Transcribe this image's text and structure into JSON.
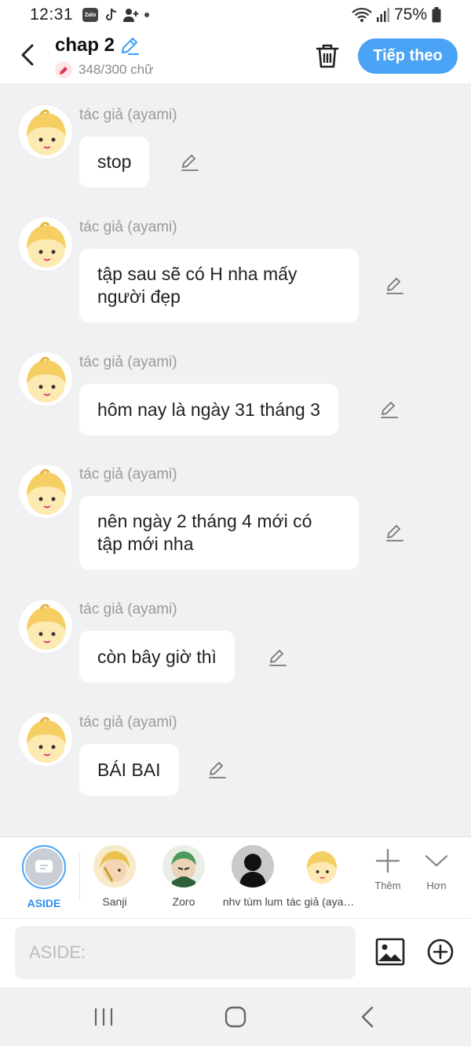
{
  "status_bar": {
    "time": "12:31",
    "battery": "75%",
    "icons": [
      "zalo-icon",
      "tiktok-icon",
      "person-add-icon",
      "dot-icon",
      "wifi-icon",
      "signal-icon",
      "battery-icon"
    ]
  },
  "header": {
    "title": "chap 2",
    "word_count": "348/300 chữ",
    "next_label": "Tiếp theo",
    "accent_color": "#4aa3f5"
  },
  "messages": [
    {
      "author": "tác giả (ayami)",
      "text": "stop"
    },
    {
      "author": "tác giả (ayami)",
      "text": "tập sau sẽ có H nha mấy người đẹp"
    },
    {
      "author": "tác giả (ayami)",
      "text": "hôm nay là ngày 31 tháng 3"
    },
    {
      "author": "tác giả (ayami)",
      "text": "nên ngày 2 tháng 4 mới có tập mới nha"
    },
    {
      "author": "tác giả (ayami)",
      "text": "còn bây giờ thì"
    },
    {
      "author": "tác giả (ayami)",
      "text": "BÁI BAI"
    }
  ],
  "characters": [
    {
      "name": "ASIDE",
      "selected": true
    },
    {
      "name": "Sanji"
    },
    {
      "name": "Zoro"
    },
    {
      "name": "nhv tùm lum"
    },
    {
      "name": "tác giả (ayami)"
    }
  ],
  "tools": [
    {
      "label": "Thêm",
      "icon": "plus-icon"
    },
    {
      "label": "Hơn",
      "icon": "chevron-down-icon"
    }
  ],
  "input": {
    "placeholder": "ASIDE:"
  }
}
